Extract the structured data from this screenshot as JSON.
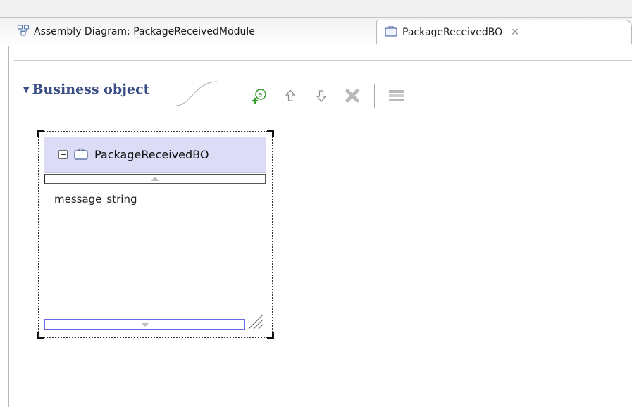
{
  "tabs": [
    {
      "label": "Assembly Diagram: PackageReceivedModule",
      "icon": "assembly-diagram-icon",
      "active": false
    },
    {
      "label": "PackageReceivedBO",
      "icon": "business-object-icon",
      "active": true,
      "close": "✕"
    }
  ],
  "section": {
    "title": "Business object",
    "expanded": true
  },
  "toolbar": {
    "buttons": [
      "add-attribute-icon",
      "move-up-icon",
      "move-down-icon",
      "delete-icon",
      "show-layout-icon"
    ],
    "colors": {
      "add": "#3b9b2f",
      "arrows": "#8a8a8a",
      "delete": "#b9b9b9",
      "layout": "#9a9a9a"
    }
  },
  "business_object": {
    "name": "PackageReceivedBO",
    "attributes": [
      {
        "name": "message",
        "type": "string"
      }
    ],
    "header_color": "#dcdcf6"
  }
}
